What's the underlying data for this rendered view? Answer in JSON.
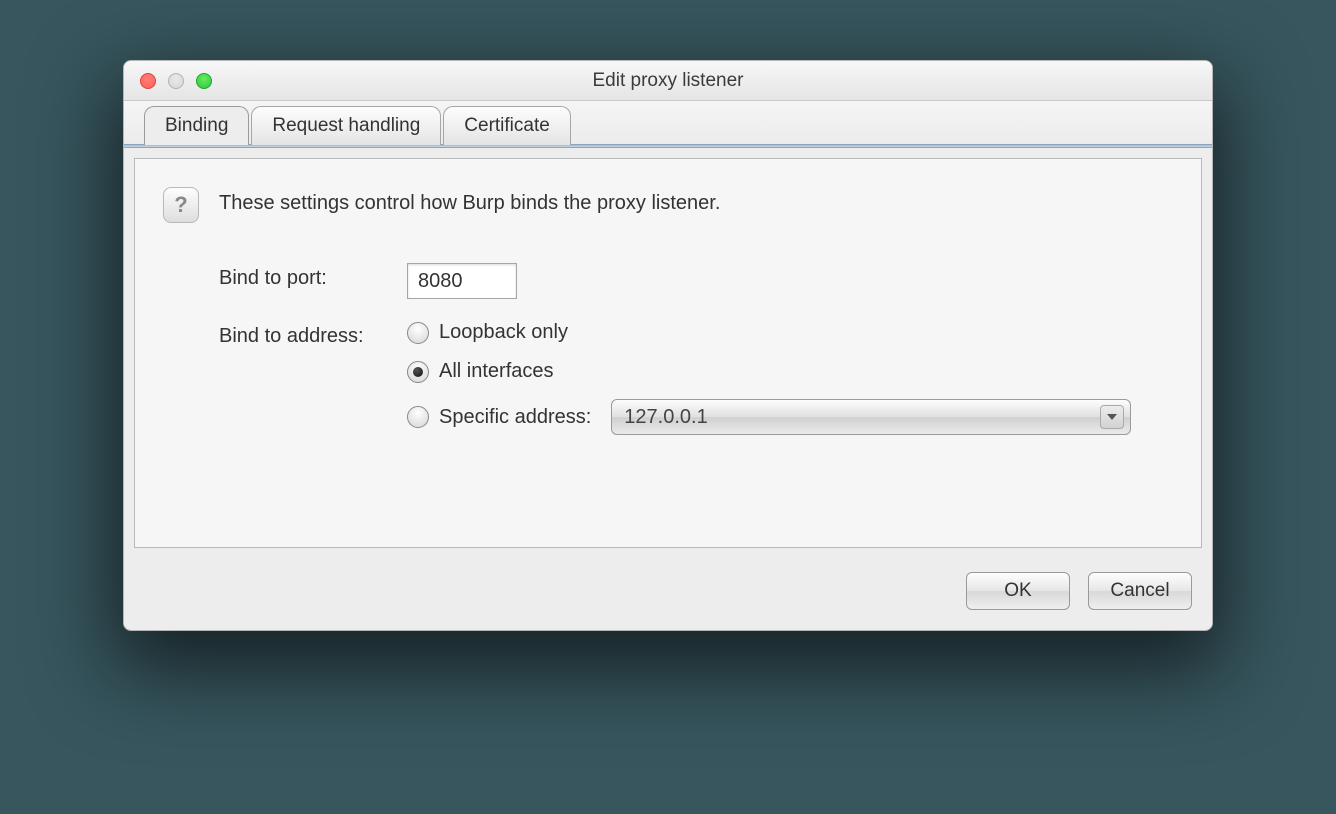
{
  "window": {
    "title": "Edit proxy listener"
  },
  "tabs": [
    {
      "label": "Binding",
      "active": true
    },
    {
      "label": "Request handling",
      "active": false
    },
    {
      "label": "Certificate",
      "active": false
    }
  ],
  "panel": {
    "description": "These settings control how Burp binds the proxy listener.",
    "port_label": "Bind to port:",
    "port_value": "8080",
    "address_label": "Bind to address:",
    "radio_loopback": "Loopback only",
    "radio_all": "All interfaces",
    "radio_specific": "Specific address:",
    "selected_radio": "all",
    "specific_address_value": "127.0.0.1"
  },
  "buttons": {
    "ok": "OK",
    "cancel": "Cancel"
  }
}
